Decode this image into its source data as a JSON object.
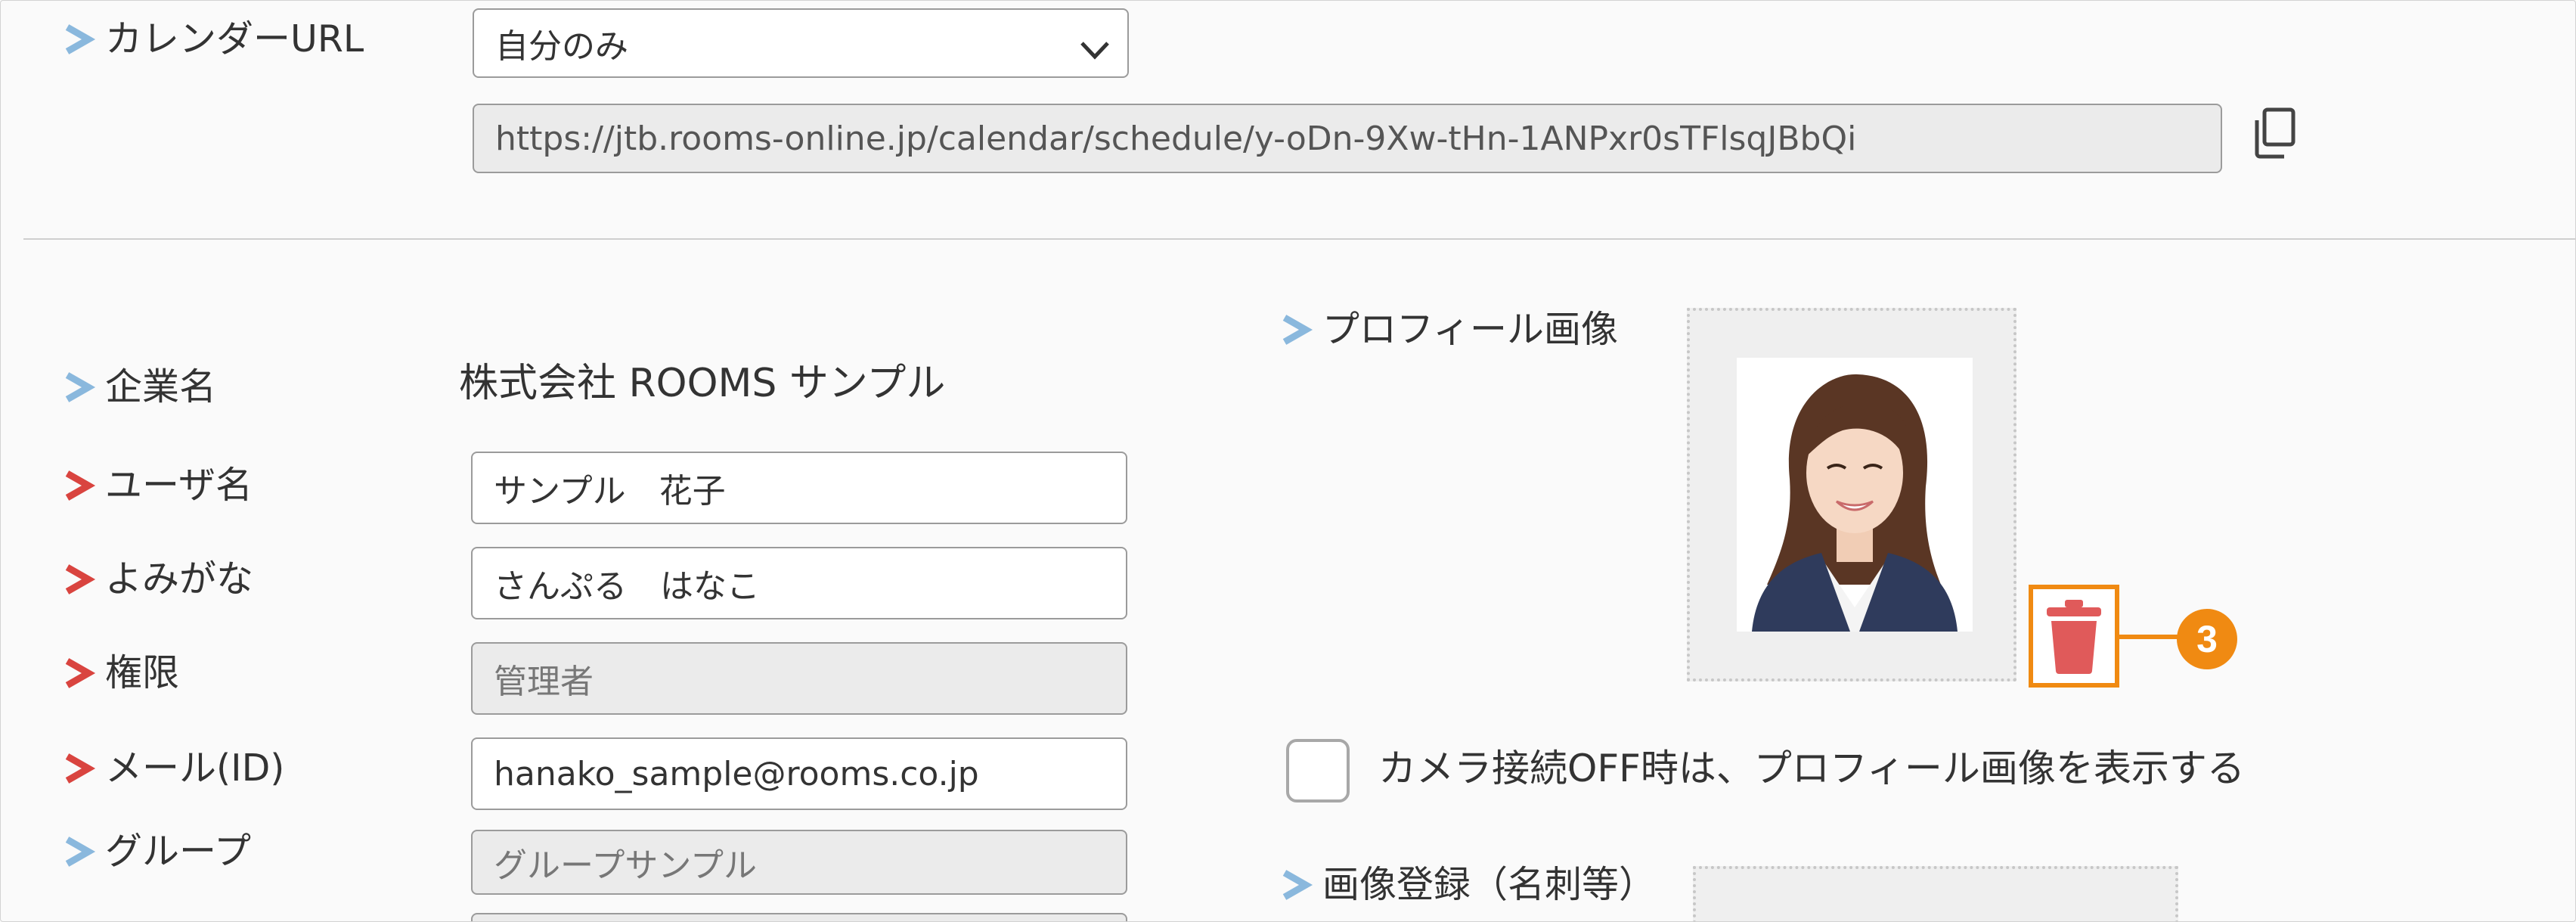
{
  "colors": {
    "arrow_optional": "#8ab8dd",
    "arrow_required": "#d9443f",
    "accent": "#f08a12",
    "trash": "#e05a5a"
  },
  "calendar": {
    "label": "カレンダーURL",
    "select_value": "自分のみ",
    "url": "https://jtb.rooms-online.jp/calendar/schedule/y-oDn-9Xw-tHn-1ANPxr0sTFlsqJBbQi",
    "copy_icon": "copy-icon"
  },
  "form": {
    "company": {
      "label": "企業名",
      "value": "株式会社 ROOMS サンプル"
    },
    "username": {
      "label": "ユーザ名",
      "value": "サンプル　花子"
    },
    "yomigana": {
      "label": "よみがな",
      "value": "さんぷる　はなこ"
    },
    "role": {
      "label": "権限",
      "value": "管理者"
    },
    "email": {
      "label": "メール(ID)",
      "value": "hanako_sample@rooms.co.jp"
    },
    "group": {
      "label": "グループ",
      "value": "グループサンプル"
    }
  },
  "profile": {
    "label": "プロフィール画像",
    "delete_icon": "trash-icon",
    "callout_number": "3",
    "camera_checkbox_label": "カメラ接続OFF時は、プロフィール画像を表示する",
    "card_label": "画像登録（名刺等）"
  }
}
